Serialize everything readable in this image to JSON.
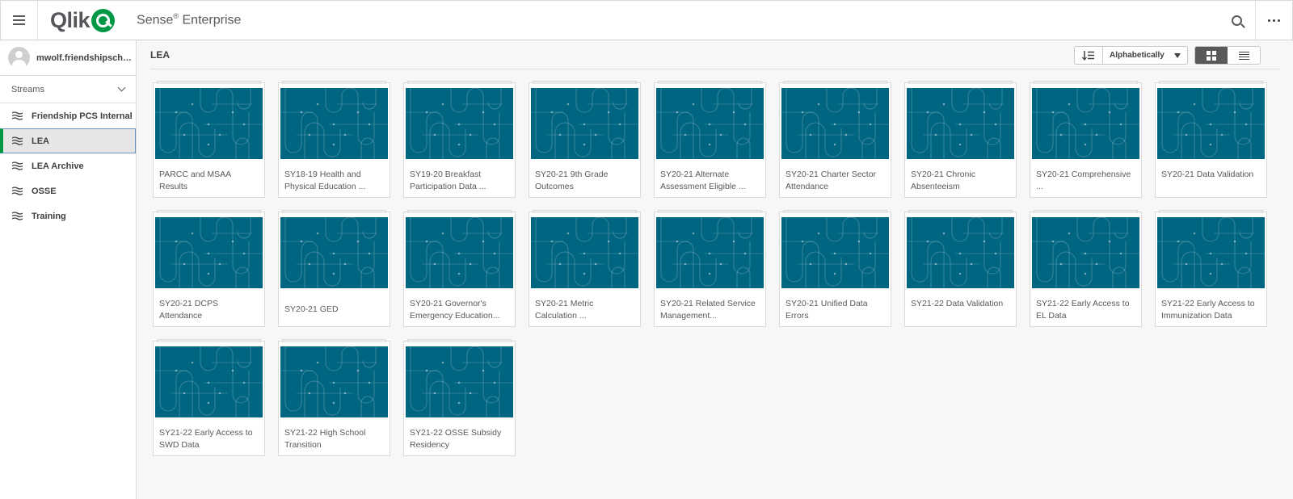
{
  "header": {
    "logo_text": "Qlik",
    "product": "Sense",
    "product_reg": "®",
    "product_suffix": " Enterprise"
  },
  "sidebar": {
    "username": "mwolf.friendshipscho...",
    "streams_label": "Streams",
    "items": [
      {
        "label": "Friendship PCS Internal"
      },
      {
        "label": "LEA"
      },
      {
        "label": "LEA Archive"
      },
      {
        "label": "OSSE"
      },
      {
        "label": "Training"
      }
    ]
  },
  "main": {
    "title": "LEA",
    "sort_label": "Alphabetically",
    "apps": [
      {
        "title": "PARCC and MSAA Results"
      },
      {
        "title": "SY18-19 Health and Physical Education ..."
      },
      {
        "title": "SY19-20 Breakfast Participation Data ..."
      },
      {
        "title": "SY20-21 9th Grade Outcomes"
      },
      {
        "title": "SY20-21 Alternate Assessment Eligible ..."
      },
      {
        "title": "SY20-21 Charter Sector Attendance"
      },
      {
        "title": "SY20-21 Chronic Absenteeism"
      },
      {
        "title": "SY20-21 Comprehensive ..."
      },
      {
        "title": "SY20-21 Data Validation"
      },
      {
        "title": "SY20-21 DCPS Attendance"
      },
      {
        "title": "SY20-21 GED"
      },
      {
        "title": "SY20-21 Governor's Emergency Education..."
      },
      {
        "title": "SY20-21 Metric Calculation ..."
      },
      {
        "title": "SY20-21 Related Service Management..."
      },
      {
        "title": "SY20-21 Unified Data Errors"
      },
      {
        "title": "SY21-22 Data Validation"
      },
      {
        "title": "SY21-22 Early Access to EL Data"
      },
      {
        "title": "SY21-22 Early Access to Immunization Data"
      },
      {
        "title": "SY21-22 Early Access to SWD Data"
      },
      {
        "title": "SY21-22 High School Transition"
      },
      {
        "title": "SY21-22 OSSE Subsidy Residency"
      }
    ]
  },
  "colors": {
    "brand_green": "#009845",
    "thumb_teal": "#006580",
    "active_bg": "#e6e6e6"
  }
}
